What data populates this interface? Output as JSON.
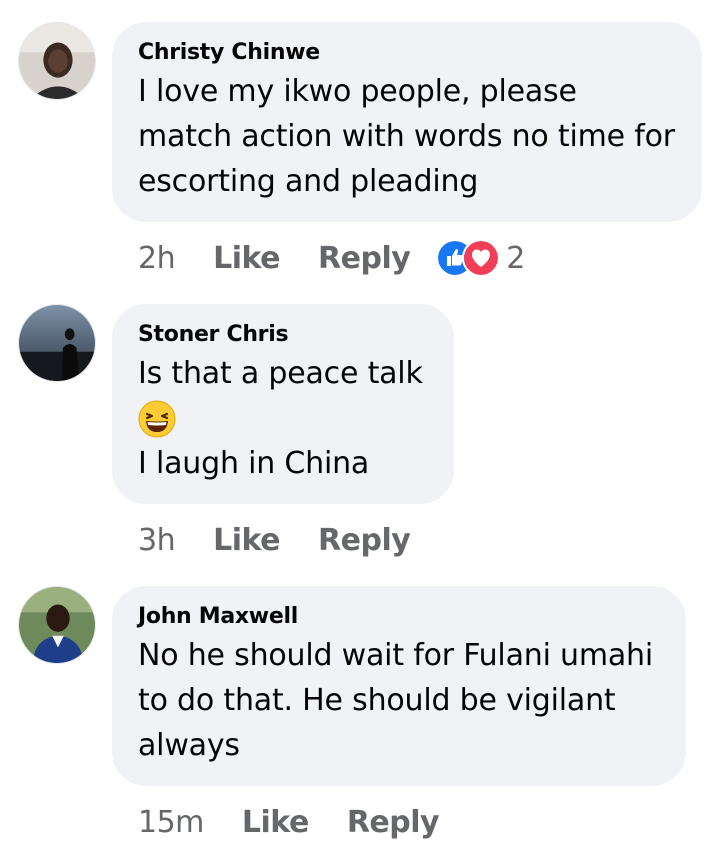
{
  "comments": [
    {
      "author": "Christy Chinwe",
      "text": "I love my ikwo people, please match action with words no time for escorting and pleading",
      "time": "2h",
      "like_label": "Like",
      "reply_label": "Reply",
      "reactions": {
        "icons": [
          "like-icon",
          "love-icon"
        ],
        "count": "2"
      }
    },
    {
      "author": "Stoner Chris",
      "text_line1": "Is that a peace  talk",
      "emoji": "grinning-squinting-face-emoji",
      "text_line2": "I laugh in China",
      "time": "3h",
      "like_label": "Like",
      "reply_label": "Reply"
    },
    {
      "author": "John Maxwell",
      "text": "No he should wait for Fulani umahi to do that. He should be vigilant always",
      "time": "15m",
      "like_label": "Like",
      "reply_label": "Reply"
    }
  ],
  "colors": {
    "bubble": "#f0f2f5",
    "text": "#050505",
    "meta": "#65676b",
    "like_blue": "#1877f2",
    "love_red": "#f33e58"
  }
}
